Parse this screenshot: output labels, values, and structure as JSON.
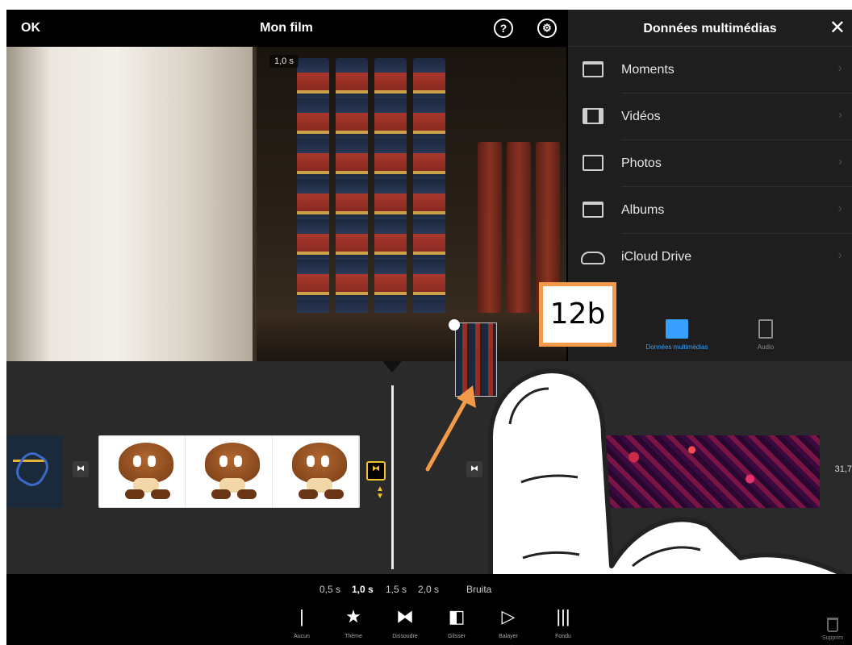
{
  "topbar": {
    "ok_label": "OK",
    "title": "Mon film",
    "help_glyph": "?",
    "settings_glyph": "⚙"
  },
  "preview": {
    "clip_time": "1,0 s"
  },
  "media_panel": {
    "title": "Données multimédias",
    "close_glyph": "✕",
    "items": [
      {
        "label": "Moments",
        "icon": "stack-icon"
      },
      {
        "label": "Vidéos",
        "icon": "film-icon"
      },
      {
        "label": "Photos",
        "icon": "photo-icon"
      },
      {
        "label": "Albums",
        "icon": "album-icon"
      },
      {
        "label": "iCloud Drive",
        "icon": "cloud-icon"
      }
    ],
    "tabs": [
      {
        "label": "Données multimédias",
        "active": true,
        "color": "#3aa0ff"
      },
      {
        "label": "Audio",
        "active": false,
        "color": "#8a8a8a"
      }
    ]
  },
  "callout": {
    "text": "12b",
    "border_color": "#f39a4a"
  },
  "timeline": {
    "end_time": "31,7",
    "transition_glyph": "⧓",
    "accent_color": "#f2c230"
  },
  "speed_options": {
    "items": [
      "0,5 s",
      "1,0 s",
      "1,5 s",
      "2,0 s"
    ],
    "selected": "1,0 s",
    "extra": "Bruita"
  },
  "toolbar": {
    "tools": [
      {
        "label": "Aucun",
        "glyph": "|"
      },
      {
        "label": "Thème",
        "glyph": "★"
      },
      {
        "label": "Dissoudre",
        "glyph": "⧓"
      },
      {
        "label": "Glisser",
        "glyph": "◧"
      },
      {
        "label": "Balayer",
        "glyph": "▷"
      },
      {
        "label": "Fondu",
        "glyph": "|||"
      }
    ],
    "trash_label": "Supprim"
  }
}
